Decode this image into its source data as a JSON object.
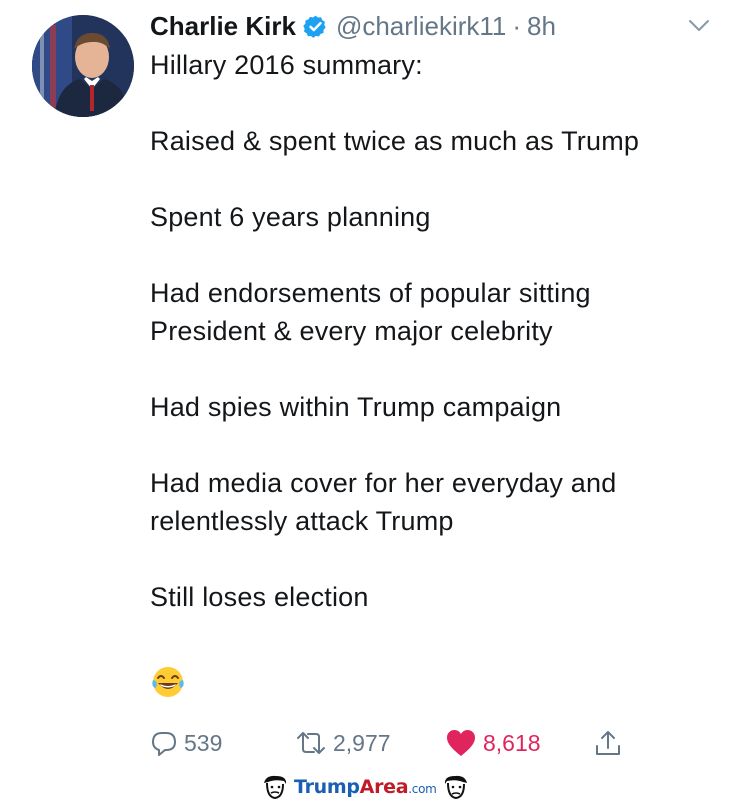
{
  "tweet": {
    "author_name": "Charlie Kirk",
    "handle": "@charliekirk11",
    "separator": "·",
    "time": "8h",
    "lines": [
      "Hillary 2016 summary:",
      "",
      "Raised & spent twice as much as Trump",
      "",
      "Spent 6 years planning",
      "",
      "Had endorsements of popular sitting",
      "President & every major celebrity",
      "",
      "Had spies within Trump campaign",
      "",
      "Had media cover for her everyday and",
      "relentlessly attack Trump",
      "",
      "Still loses election"
    ],
    "emoji": "face-with-tears-of-joy"
  },
  "actions": {
    "reply_count": "539",
    "retweet_count": "2,977",
    "like_count": "8,618"
  },
  "watermark": {
    "part1": "Trump",
    "part2": "Area",
    "part3": ".com"
  },
  "colors": {
    "verified": "#1da1f2",
    "like": "#e0245e",
    "muted": "#657786"
  }
}
